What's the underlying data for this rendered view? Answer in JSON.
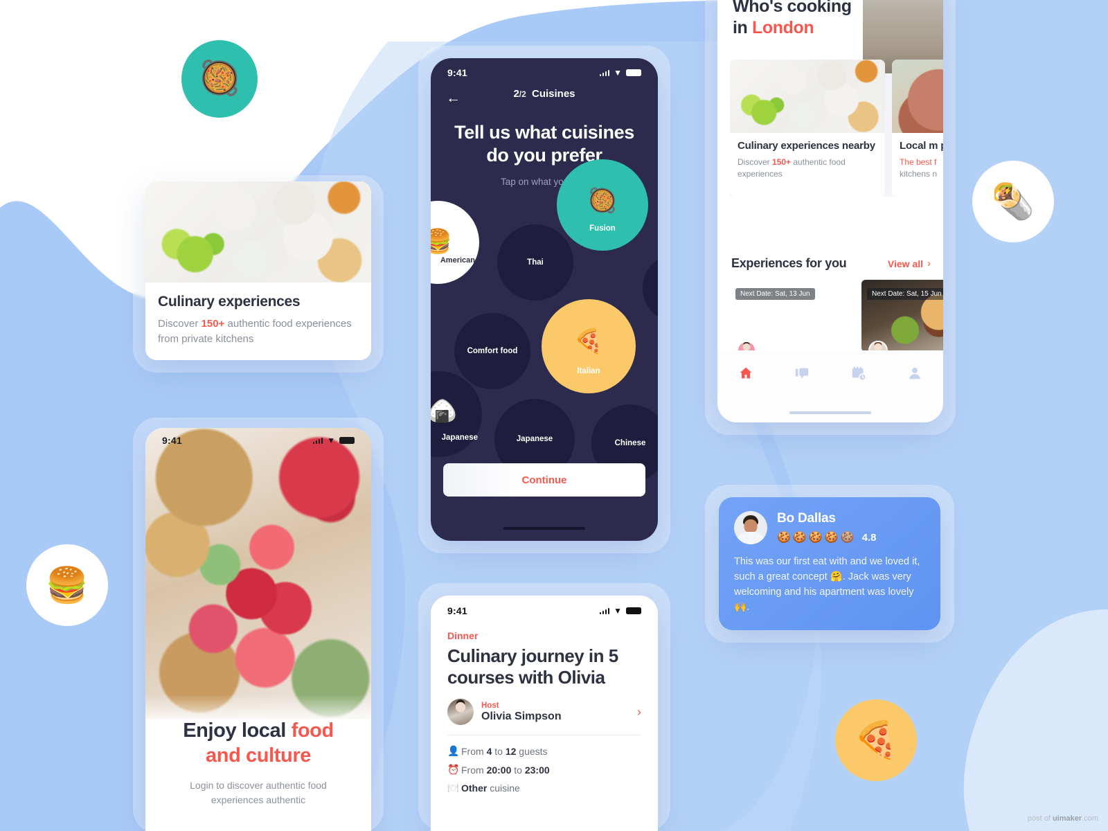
{
  "colors": {
    "accent_red": "#f8574e",
    "bg_blue": "#a8c8f5",
    "dark_navy": "#2c2b4e",
    "bubble_navy": "#1e1d3e",
    "teal": "#2fbfae",
    "yellow": "#fbc96a",
    "review_blue": "#5e93f2"
  },
  "onboarding_phone": {
    "status": {
      "time": "9:41",
      "signal_icon": "cellular-signal-icon",
      "wifi_icon": "wifi-icon",
      "battery_icon": "battery-icon"
    },
    "back_icon": "back-arrow-icon",
    "step_current": "2",
    "step_separator": "/",
    "step_total": "2",
    "step_label": "Cuisines",
    "title": "Tell us what cuisines do you prefer",
    "title_line1": "Tell us what cuisines",
    "title_line2": "do you prefer",
    "subtitle": "Tap on what you like.",
    "continue_label": "Continue",
    "cuisines": [
      {
        "label": "American",
        "state": "partial",
        "style": "white",
        "emoji": "🍔"
      },
      {
        "label": "Thai",
        "state": "unselected",
        "style": "navy",
        "emoji": ""
      },
      {
        "label": "Fusion",
        "state": "selected",
        "style": "teal",
        "emoji": "🥘"
      },
      {
        "label": "Comfort food",
        "state": "unselected",
        "style": "navy",
        "emoji": ""
      },
      {
        "label": "Italian",
        "state": "selected",
        "style": "yellow",
        "emoji": "🍕"
      },
      {
        "label": "Japanese",
        "state": "partial",
        "style": "navy",
        "emoji": "🍙"
      },
      {
        "label": "Japanese",
        "state": "unselected",
        "style": "navy",
        "emoji": ""
      },
      {
        "label": "Chinese",
        "state": "unselected",
        "style": "navy",
        "emoji": ""
      }
    ]
  },
  "culinary_card": {
    "image_name": "brunch-table-photo",
    "title": "Culinary experiences",
    "desc_prefix": "Discover ",
    "desc_highlight": "150+",
    "desc_suffix": " authentic food experiences from private kitchens"
  },
  "login_phone": {
    "status": {
      "time": "9:41"
    },
    "image_name": "fruit-platter-photo",
    "headline_plain": "Enjoy local ",
    "headline_accent_1": "food",
    "headline_accent_2": "and culture",
    "sub_line1": "Login to discover authentic food",
    "sub_line2": "experiences authentic"
  },
  "detail_phone": {
    "status": {
      "time": "9:41"
    },
    "meal_tag": "Dinner",
    "title": "Culinary journey in 5 courses with Olivia",
    "host_label": "Host",
    "host_name": "Olivia Simpson",
    "host_avatar": "host-avatar",
    "chevron_icon": "chevron-right-icon",
    "facts": [
      {
        "icon": "guests-icon",
        "prefix": "From ",
        "b1": "4",
        "mid": " to ",
        "b2": "12",
        "suffix": " guests"
      },
      {
        "icon": "clock-icon",
        "prefix": "From ",
        "b1": "20:00",
        "mid": " to ",
        "b2": "23:00",
        "suffix": ""
      },
      {
        "icon": "cutlery-icon",
        "prefix": "",
        "b1": "Other",
        "mid": "",
        "b2": "",
        "suffix": " cuisine"
      }
    ]
  },
  "home_phone": {
    "heading_line1": "Who's cooking",
    "heading_line2_plain": "in ",
    "heading_city": "London",
    "hero_image": "bigben-photo",
    "cards": [
      {
        "image_name": "brunch-table-photo",
        "title": "Culinary experiences nearby",
        "desc_prefix": "Discover ",
        "desc_highlight": "150+",
        "desc_suffix": " authentic food experiences",
        "highlight_color": "#f8574e"
      },
      {
        "image_name": "hands-food-photo",
        "title": "Local m private",
        "desc_prefix": "",
        "desc_highlight": "The best f",
        "desc_suffix": "kitchens n",
        "highlight_color": "#f8574e"
      }
    ],
    "section_title": "Experiences for you",
    "view_all_label": "View all",
    "view_all_icon": "chevron-right-icon",
    "experiences": [
      {
        "image_name": "buddha-bowl-photo",
        "badge": "Next Date: Sat, 13 Jun",
        "avatar": "host-avatar-1"
      },
      {
        "image_name": "burger-photo",
        "badge": "Next Date: Sat, 15 Jun",
        "avatar": "host-avatar-2"
      }
    ],
    "tabbar": [
      {
        "icon": "home-icon",
        "active": true
      },
      {
        "icon": "chat-icon",
        "active": false
      },
      {
        "icon": "calendar-clock-icon",
        "active": false
      },
      {
        "icon": "profile-icon",
        "active": false
      }
    ]
  },
  "review_card": {
    "avatar": "reviewer-avatar",
    "name": "Bo Dallas",
    "rating_icon": "cookie-icon",
    "rating_count": 5,
    "rating_value": "4.8",
    "text": "This was our first eat with and we loved it, such a great concept 🤗. Jack was very welcoming and his apartment was lovely 🙌."
  },
  "floating_items": [
    {
      "name": "teal-sizzler-circle",
      "emoji": "🥘",
      "bg": "#2fbfae"
    },
    {
      "name": "white-burrito-circle",
      "emoji": "🌯",
      "bg": "#ffffff"
    },
    {
      "name": "white-burger-circle",
      "emoji": "🍔",
      "bg": "#ffffff"
    },
    {
      "name": "yellow-pizza-circle",
      "emoji": "🍕",
      "bg": "#fbc96a"
    }
  ],
  "watermark": {
    "prefix": "post of ",
    "brand": "uimaker",
    "suffix": ".com"
  }
}
